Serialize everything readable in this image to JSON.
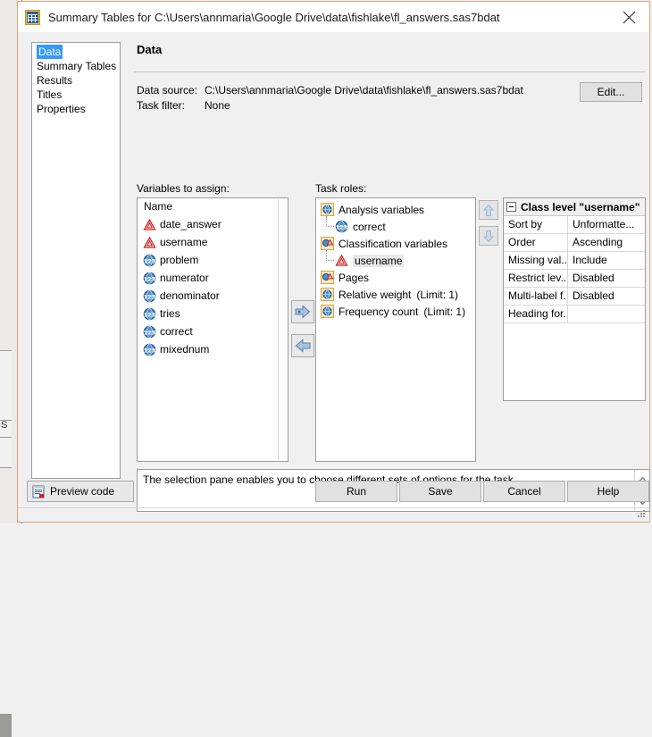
{
  "window": {
    "title": "Summary Tables for C:\\Users\\annmaria\\Google Drive\\data\\fishlake\\fl_answers.sas7bdat",
    "title_icon": "summary-tables-icon",
    "close_icon": "close-icon"
  },
  "background": {
    "side_text": "S"
  },
  "selection_pane": {
    "items": [
      {
        "label": "Data",
        "selected": true
      },
      {
        "label": "Summary Tables",
        "selected": false
      },
      {
        "label": "Results",
        "selected": false
      },
      {
        "label": "Titles",
        "selected": false
      },
      {
        "label": "Properties",
        "selected": false
      }
    ]
  },
  "page": {
    "title": "Data"
  },
  "datasource": {
    "source_label": "Data source:",
    "source_value": "C:\\Users\\annmaria\\Google Drive\\data\\fishlake\\fl_answers.sas7bdat",
    "filter_label": "Task filter:",
    "filter_value": "None",
    "edit_label": "Edit..."
  },
  "variables": {
    "label": "Variables to assign:",
    "column_header": "Name",
    "rows": [
      {
        "name": "date_answer",
        "type": "character"
      },
      {
        "name": "username",
        "type": "character"
      },
      {
        "name": "problem",
        "type": "numeric"
      },
      {
        "name": "numerator",
        "type": "numeric"
      },
      {
        "name": "denominator",
        "type": "numeric"
      },
      {
        "name": "tries",
        "type": "numeric"
      },
      {
        "name": "correct",
        "type": "numeric"
      },
      {
        "name": "mixednum",
        "type": "numeric"
      }
    ]
  },
  "transfer": {
    "assign_icon": "arrow-right-add-icon",
    "remove_icon": "arrow-left-icon"
  },
  "roles": {
    "label": "Task roles:",
    "move_up_icon": "arrow-up-icon",
    "move_down_icon": "arrow-down-icon",
    "rows": [
      {
        "label": "Analysis variables",
        "limit": "",
        "icon": "role-analysis-icon",
        "child": false,
        "highlighted": false
      },
      {
        "label": "correct",
        "limit": "",
        "icon": "numeric-variable-icon",
        "child": true,
        "highlighted": false
      },
      {
        "label": "Classification variables",
        "limit": "",
        "icon": "role-classification-icon",
        "child": false,
        "highlighted": false
      },
      {
        "label": "username",
        "limit": "",
        "icon": "character-variable-icon",
        "child": true,
        "highlighted": true
      },
      {
        "label": "Pages",
        "limit": "",
        "icon": "role-classification-icon",
        "child": false,
        "highlighted": false
      },
      {
        "label": "Relative weight",
        "limit": "(Limit: 1)",
        "icon": "role-analysis-icon",
        "child": false,
        "highlighted": false
      },
      {
        "label": "Frequency count",
        "limit": "(Limit: 1)",
        "icon": "role-analysis-icon",
        "child": false,
        "highlighted": false
      }
    ]
  },
  "properties": {
    "header": "Class level \"username\"",
    "rows": [
      {
        "name": "Sort by",
        "value": "Unformatte..."
      },
      {
        "name": "Order",
        "value": "Ascending"
      },
      {
        "name": "Missing val...",
        "value": "Include"
      },
      {
        "name": "Restrict lev...",
        "value": "Disabled"
      },
      {
        "name": "Multi-label f...",
        "value": "Disabled"
      },
      {
        "name": "Heading for...",
        "value": ""
      }
    ]
  },
  "description": {
    "text": "The selection pane enables you to choose different sets of options for the task.",
    "scroll_up_icon": "chevron-up-icon",
    "scroll_down_icon": "chevron-down-icon"
  },
  "footer": {
    "preview_code": "Preview code",
    "preview_code_icon": "preview-code-icon",
    "run": "Run",
    "save": "Save",
    "cancel": "Cancel",
    "help": "Help",
    "resize_grip_icon": "resize-grip-icon"
  },
  "colors": {
    "selection_blue": "#3399ff",
    "char_icon_red": "#cc2222",
    "num_icon_blue": "#2e6db4",
    "role_icon_gold": "#e0a23c",
    "window_border": "#d6a97e"
  }
}
